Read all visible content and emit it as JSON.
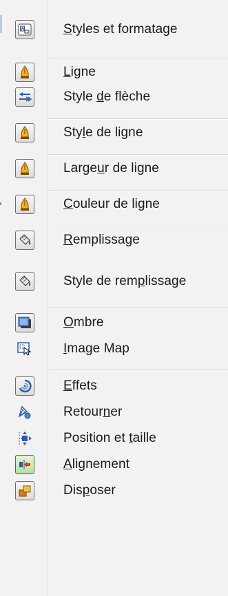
{
  "menu": {
    "items": [
      {
        "id": "styles",
        "pre": "",
        "u": "S",
        "post": "tyles et formatage",
        "icon": "styles-formatting-icon"
      },
      {
        "id": "ligne",
        "pre": "",
        "u": "L",
        "post": "igne",
        "icon": "pen-icon"
      },
      {
        "id": "style-fleche",
        "pre": "Style ",
        "u": "d",
        "post": "e flèche",
        "icon": "arrow-style-icon"
      },
      {
        "id": "style-ligne",
        "pre": "Sty",
        "u": "l",
        "post": "e de ligne",
        "icon": "pen-icon"
      },
      {
        "id": "largeur",
        "pre": "Large",
        "u": "u",
        "post": "r de ligne",
        "icon": "pen-icon"
      },
      {
        "id": "couleur",
        "pre": "",
        "u": "C",
        "post": "ouleur de ligne",
        "icon": "pen-icon"
      },
      {
        "id": "remplissage",
        "pre": "",
        "u": "R",
        "post": "emplissage",
        "icon": "paint-bucket-icon"
      },
      {
        "id": "style-remplissage",
        "pre": "Style de rem",
        "u": "p",
        "post": "lissage",
        "icon": "paint-bucket-icon"
      },
      {
        "id": "ombre",
        "pre": "",
        "u": "O",
        "post": "mbre",
        "icon": "shadow-icon"
      },
      {
        "id": "image-map",
        "pre": "",
        "u": "I",
        "post": "mage Map",
        "icon": "image-map-icon"
      },
      {
        "id": "effets",
        "pre": "",
        "u": "E",
        "post": "ffets",
        "icon": "effects-icon"
      },
      {
        "id": "retourner",
        "pre": "Retour",
        "u": "n",
        "post": "er",
        "icon": "flip-icon"
      },
      {
        "id": "position",
        "pre": "Position et ",
        "u": "t",
        "post": "aille",
        "icon": "position-size-icon"
      },
      {
        "id": "alignement",
        "pre": "",
        "u": "A",
        "post": "lignement",
        "icon": "alignment-icon"
      },
      {
        "id": "disposer",
        "pre": "Dis",
        "u": "p",
        "post": "oser",
        "icon": "arrange-icon"
      }
    ]
  }
}
